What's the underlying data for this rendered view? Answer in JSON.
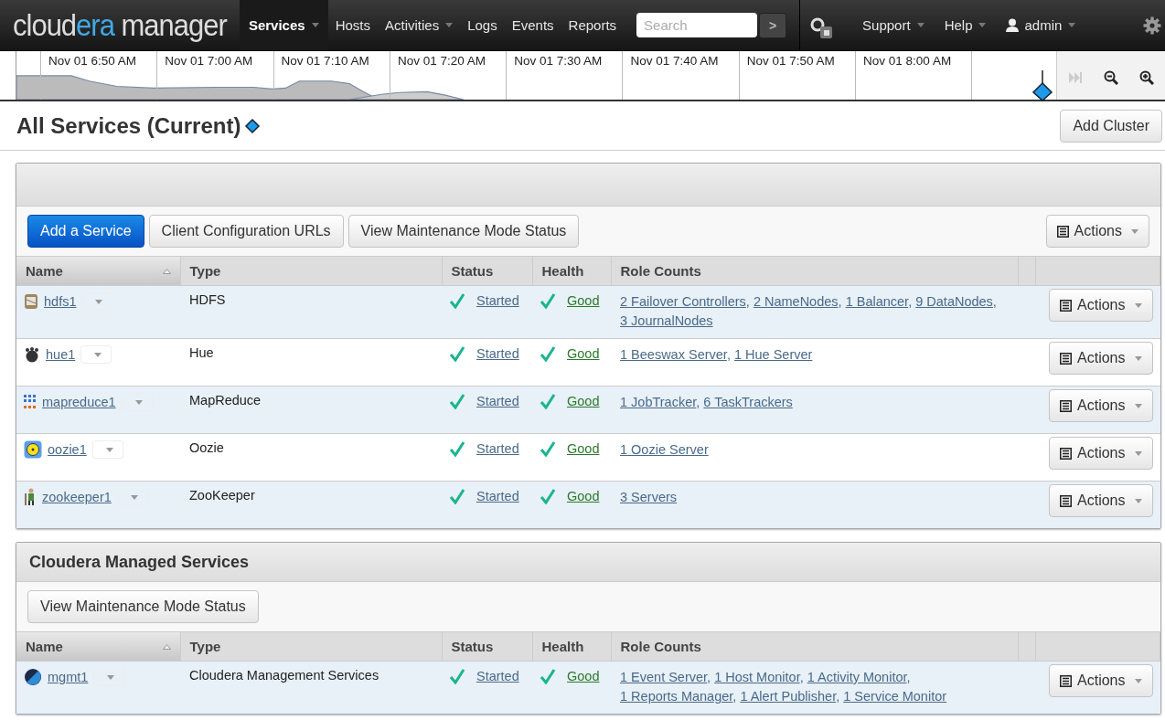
{
  "header": {
    "logo": [
      {
        "text": "cloud",
        "accent": false
      },
      {
        "text": "era",
        "accent": true
      },
      {
        "text": " manager",
        "accent": false
      }
    ],
    "nav": [
      {
        "label": "Services",
        "selected": true,
        "has_menu": true
      },
      {
        "label": "Hosts",
        "selected": false,
        "has_menu": false
      },
      {
        "label": "Activities",
        "selected": false,
        "has_menu": true
      },
      {
        "label": "Logs",
        "selected": false,
        "has_menu": false
      },
      {
        "label": "Events",
        "selected": false,
        "has_menu": false
      },
      {
        "label": "Reports",
        "selected": false,
        "has_menu": false
      }
    ],
    "search": {
      "placeholder": "Search",
      "go": ">"
    },
    "right_menu": [
      {
        "label": "Support",
        "kind": "menu"
      },
      {
        "label": "Help",
        "kind": "menu"
      },
      {
        "label": "admin",
        "kind": "user"
      }
    ]
  },
  "timeline": {
    "ticks": [
      "Nov 01 6:50 AM",
      "Nov 01 7:00 AM",
      "Nov 01 7:10 AM",
      "Nov 01 7:20 AM",
      "Nov 01 7:30 AM",
      "Nov 01 7:40 AM",
      "Nov 01 7:50 AM",
      "Nov 01 8:00 AM"
    ]
  },
  "page": {
    "title": "All Services (Current)",
    "add_cluster": "Add Cluster"
  },
  "panels": [
    {
      "buttons": [
        {
          "label": "Add a Service",
          "primary": true
        },
        {
          "label": "Client Configuration URLs",
          "primary": false
        },
        {
          "label": "View Maintenance Mode Status",
          "primary": false
        }
      ],
      "actions_button": "Actions",
      "table": {
        "columns": [
          {
            "label": "Name",
            "sorted": true
          },
          {
            "label": "Type",
            "sorted": false
          },
          {
            "label": "Status",
            "sorted": false
          },
          {
            "label": "Health",
            "sorted": false
          },
          {
            "label": "Role Counts",
            "sorted": false
          }
        ],
        "rows": [
          {
            "kind": "hdfs",
            "name": "hdfs1",
            "type": "HDFS",
            "status": "Started",
            "health": "Good",
            "roles": [
              {
                "label": "2 Failover Controllers",
                "sep": ","
              },
              {
                "label": "2 NameNodes",
                "sep": ","
              },
              {
                "label": "1 Balancer",
                "sep": ","
              },
              {
                "label": "9 DataNodes",
                "sep": ","
              },
              {
                "label": "3 JournalNodes"
              }
            ],
            "action": "Actions"
          },
          {
            "kind": "hue",
            "name": "hue1",
            "type": "Hue",
            "status": "Started",
            "health": "Good",
            "roles": [
              {
                "label": "1 Beeswax Server",
                "sep": ","
              },
              {
                "label": "1 Hue Server"
              }
            ],
            "action": "Actions"
          },
          {
            "kind": "mapreduce",
            "name": "mapreduce1",
            "type": "MapReduce",
            "status": "Started",
            "health": "Good",
            "roles": [
              {
                "label": "1 JobTracker",
                "sep": ","
              },
              {
                "label": "6 TaskTrackers"
              }
            ],
            "action": "Actions"
          },
          {
            "kind": "oozie",
            "name": "oozie1",
            "type": "Oozie",
            "status": "Started",
            "health": "Good",
            "roles": [
              {
                "label": "1 Oozie Server"
              }
            ],
            "action": "Actions"
          },
          {
            "kind": "zookeeper",
            "name": "zookeeper1",
            "type": "ZooKeeper",
            "status": "Started",
            "health": "Good",
            "roles": [
              {
                "label": "3 Servers"
              }
            ],
            "action": "Actions"
          }
        ]
      }
    },
    {
      "title": "Cloudera Managed Services",
      "buttons": [
        {
          "label": "View Maintenance Mode Status",
          "primary": false
        }
      ],
      "table": {
        "columns": [
          {
            "label": "Name",
            "sorted": true
          },
          {
            "label": "Type",
            "sorted": false
          },
          {
            "label": "Status",
            "sorted": false
          },
          {
            "label": "Health",
            "sorted": false
          },
          {
            "label": "Role Counts",
            "sorted": false
          }
        ],
        "rows": [
          {
            "kind": "mgmt",
            "name": "mgmt1",
            "type": "Cloudera Management Services",
            "status": "Started",
            "health": "Good",
            "roles": [
              {
                "label": "1 Event Server",
                "sep": ","
              },
              {
                "label": "1 Host Monitor",
                "sep": ","
              },
              {
                "label": "1 Activity Monitor",
                "sep": ","
              },
              {
                "label": "1 Reports Manager",
                "sep": ","
              },
              {
                "label": "1 Alert Publisher",
                "sep": ","
              },
              {
                "label": "1 Service Monitor"
              }
            ],
            "action": "Actions"
          }
        ]
      }
    }
  ]
}
